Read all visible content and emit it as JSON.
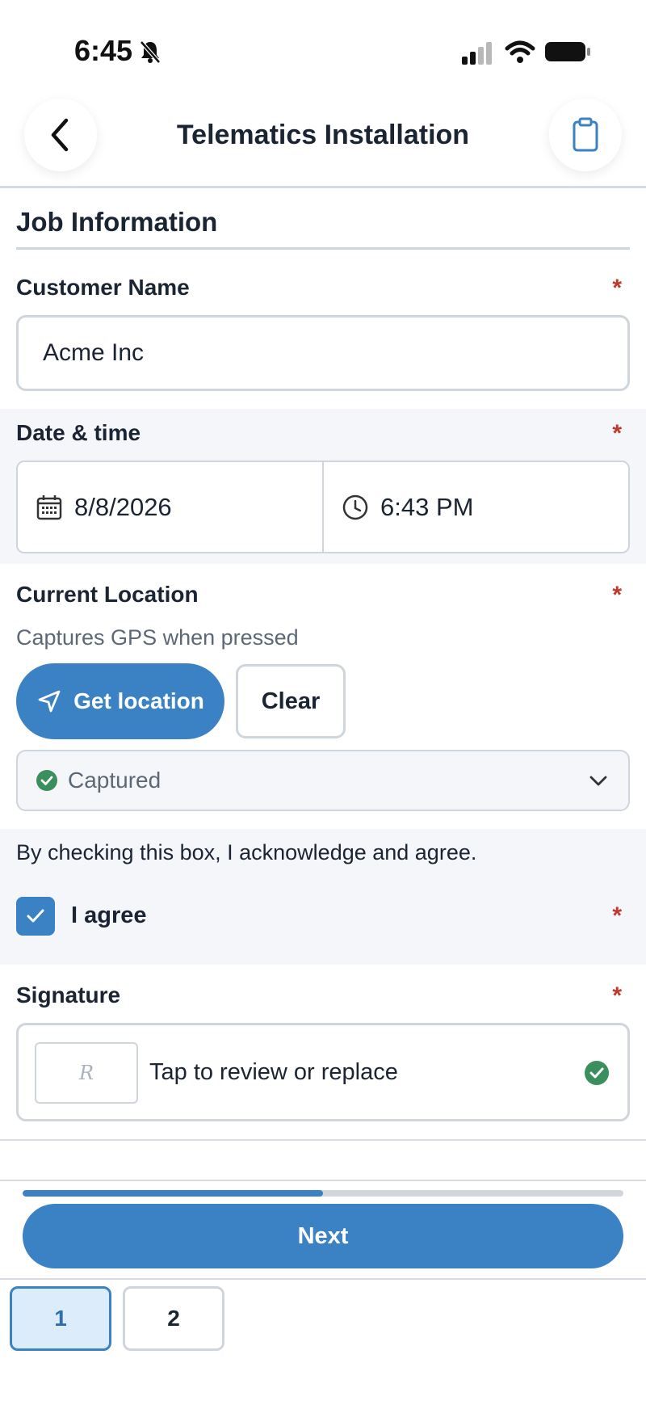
{
  "status_bar": {
    "time": "6:45"
  },
  "header": {
    "title": "Telematics Installation"
  },
  "section": {
    "title": "Job Information"
  },
  "fields": {
    "customer_name": {
      "label": "Customer Name",
      "value": "Acme Inc",
      "required": "*"
    },
    "date_time": {
      "label": "Date & time",
      "date": "8/8/2026",
      "time": "6:43 PM",
      "required": "*"
    },
    "location": {
      "label": "Current Location",
      "helper": "Captures GPS when pressed",
      "get_button": "Get location",
      "clear_button": "Clear",
      "status": "Captured",
      "required": "*"
    },
    "acknowledge": {
      "text": "By checking this box, I acknowledge and agree.",
      "checkbox_label": "I agree",
      "checked": true,
      "required": "*"
    },
    "signature": {
      "label": "Signature",
      "action_text": "Tap to review or replace",
      "thumb_glyph": "R",
      "required": "*"
    }
  },
  "footer": {
    "progress_fraction": 0.5,
    "next_button": "Next",
    "pages": [
      "1",
      "2"
    ],
    "current_page": "1"
  },
  "colors": {
    "accent": "#3a82c4",
    "required": "#c0392b",
    "success": "#3a8f5c",
    "border": "#cfd5dd"
  }
}
